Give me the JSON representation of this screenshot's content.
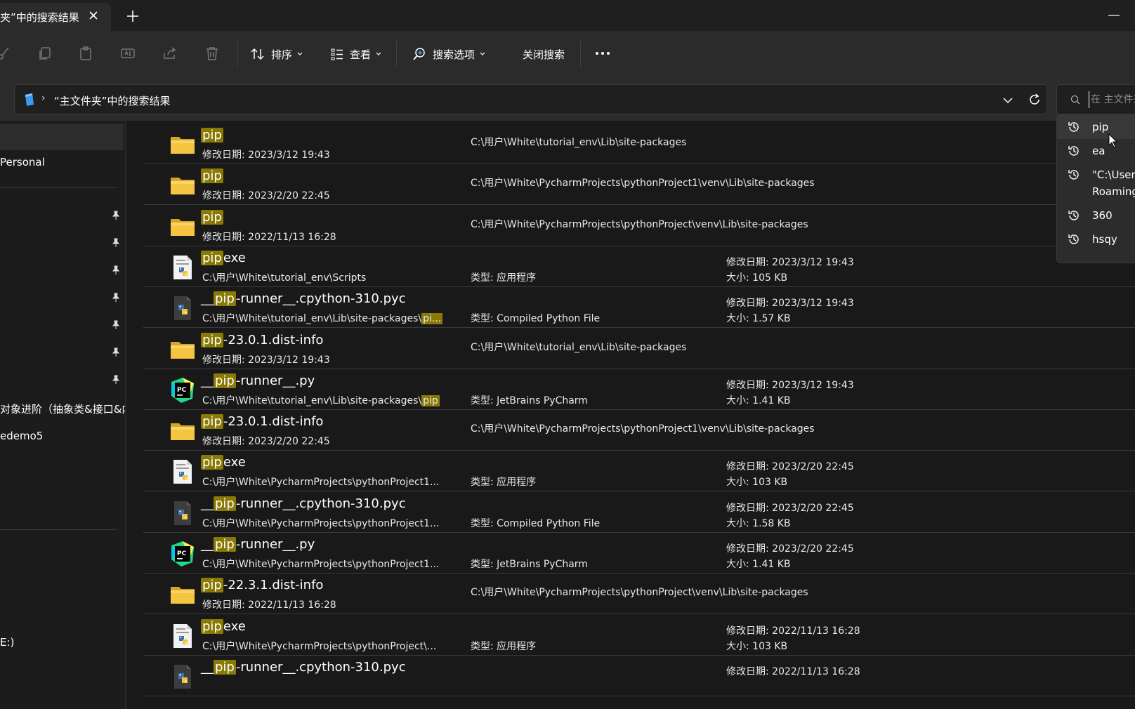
{
  "tab": {
    "title": "夹”中的搜索结果"
  },
  "toolbar": {
    "sort_label": "排序",
    "view_label": "查看",
    "search_options_label": "搜索选项",
    "close_search_label": "关闭搜索"
  },
  "address": {
    "path_label": "“主文件夹”中的搜索结果",
    "search_placeholder": "在 主文件夹"
  },
  "sidebar": {
    "items": [
      {
        "label": "Personal"
      },
      {
        "label": "对象进阶（抽象类&接口&内"
      },
      {
        "label": "edemo5"
      },
      {
        "label": "E:)"
      }
    ]
  },
  "results": [
    {
      "icon": "folder-icon",
      "hl": "pip",
      "rest": "",
      "sub": "修改日期: 2023/3/12 19:43",
      "loc": "C:\\用户\\White\\tutorial_env\\Lib\\site-packages"
    },
    {
      "icon": "folder-icon",
      "hl": "pip",
      "rest": "",
      "sub": "修改日期: 2023/2/20 22:45",
      "loc": "C:\\用户\\White\\PycharmProjects\\pythonProject1\\venv\\Lib\\site-packages"
    },
    {
      "icon": "folder-icon",
      "hl": "pip",
      "rest": "",
      "sub": "修改日期: 2022/11/13 16:28",
      "loc": "C:\\用户\\White\\PycharmProjects\\pythonProject\\venv\\Lib\\site-packages"
    },
    {
      "icon": "python-exe-icon",
      "pre": "",
      "hl": "pip",
      "rest": "exe",
      "sub": "C:\\用户\\White\\tutorial_env\\Scripts",
      "type": "类型: 应用程序",
      "date": "修改日期: 2023/3/12 19:43",
      "size": "大小: 105 KB"
    },
    {
      "icon": "python-file-icon",
      "pre": "__",
      "hl": "pip",
      "rest": "-runner__.cpython-310.pyc",
      "sub": "C:\\用户\\White\\tutorial_env\\Lib\\site-packages\\",
      "subhl": "pi...",
      "type": "类型: Compiled Python File",
      "date": "修改日期: 2023/3/12 19:43",
      "size": "大小: 1.57 KB"
    },
    {
      "icon": "folder-icon",
      "hl": "pip",
      "rest": "-23.0.1.dist-info",
      "sub": "修改日期: 2023/3/12 19:43",
      "loc": "C:\\用户\\White\\tutorial_env\\Lib\\site-packages"
    },
    {
      "icon": "pycharm-icon",
      "pre": "__",
      "hl": "pip",
      "rest": "-runner__.py",
      "sub": "C:\\用户\\White\\tutorial_env\\Lib\\site-packages\\",
      "subhl": "pip",
      "type": "类型: JetBrains PyCharm",
      "date": "修改日期: 2023/3/12 19:43",
      "size": "大小: 1.41 KB"
    },
    {
      "icon": "folder-icon",
      "hl": "pip",
      "rest": "-23.0.1.dist-info",
      "sub": "修改日期: 2023/2/20 22:45",
      "loc": "C:\\用户\\White\\PycharmProjects\\pythonProject1\\venv\\Lib\\site-packages"
    },
    {
      "icon": "python-exe-icon",
      "pre": "",
      "hl": "pip",
      "rest": "exe",
      "sub": "C:\\用户\\White\\PycharmProjects\\pythonProject1...",
      "type": "类型: 应用程序",
      "date": "修改日期: 2023/2/20 22:45",
      "size": "大小: 103 KB"
    },
    {
      "icon": "python-file-icon",
      "pre": "__",
      "hl": "pip",
      "rest": "-runner__.cpython-310.pyc",
      "sub": "C:\\用户\\White\\PycharmProjects\\pythonProject1...",
      "type": "类型: Compiled Python File",
      "date": "修改日期: 2023/2/20 22:45",
      "size": "大小: 1.58 KB"
    },
    {
      "icon": "pycharm-icon",
      "pre": "__",
      "hl": "pip",
      "rest": "-runner__.py",
      "sub": "C:\\用户\\White\\PycharmProjects\\pythonProject1...",
      "type": "类型: JetBrains PyCharm",
      "date": "修改日期: 2023/2/20 22:45",
      "size": "大小: 1.41 KB"
    },
    {
      "icon": "folder-icon",
      "hl": "pip",
      "rest": "-22.3.1.dist-info",
      "sub": "修改日期: 2022/11/13 16:28",
      "loc": "C:\\用户\\White\\PycharmProjects\\pythonProject\\venv\\Lib\\site-packages"
    },
    {
      "icon": "python-exe-icon",
      "pre": "",
      "hl": "pip",
      "rest": "exe",
      "sub": "C:\\用户\\White\\PycharmProjects\\pythonProject\\...",
      "type": "类型: 应用程序",
      "date": "修改日期: 2022/11/13 16:28",
      "size": "大小: 103 KB"
    },
    {
      "icon": "python-file-icon",
      "pre": "__",
      "hl": "pip",
      "rest": "-runner__.cpython-310.pyc",
      "sub": "",
      "type": "",
      "date": "修改日期: 2022/11/13 16:28",
      "size": ""
    }
  ],
  "history": [
    {
      "text": "pip"
    },
    {
      "text": "ea"
    },
    {
      "text": "\"C:\\Users"
    },
    {
      "text": "Roaming"
    },
    {
      "text": "360"
    },
    {
      "text": "hsqy"
    }
  ],
  "colors": {
    "highlight": "#8a7a05",
    "folder": "#f5c542",
    "background": "#191919",
    "toolbar": "#2b2b2b"
  }
}
